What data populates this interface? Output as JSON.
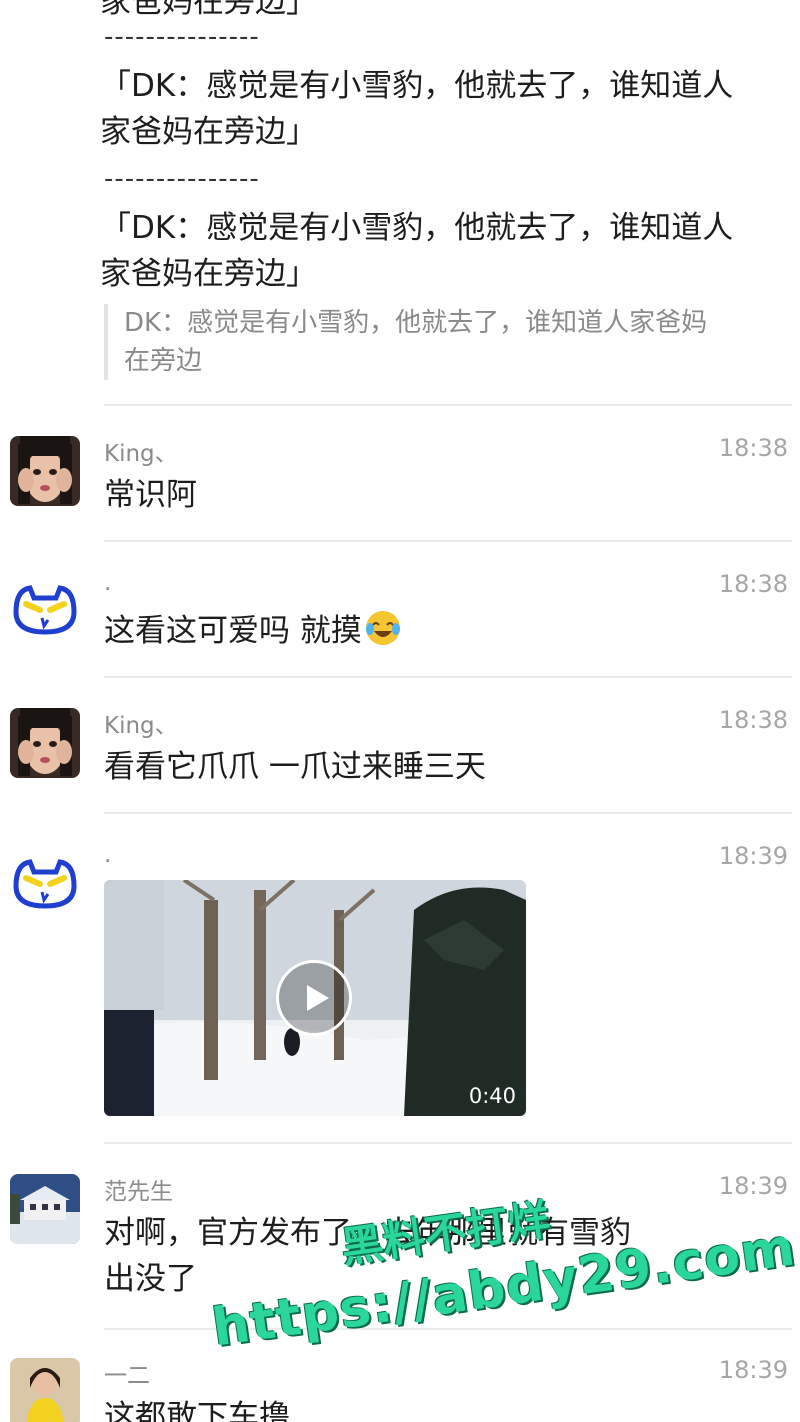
{
  "quotes": {
    "top_partial": "家爸妈在旁边」",
    "separator": "---------------",
    "q1_line1": "「DK：感觉是有小雪豹，他就去了，谁知道人",
    "q1_line2": "家爸妈在旁边」",
    "q2_line1": "「DK：感觉是有小雪豹，他就去了，谁知道人",
    "q2_line2": "家爸妈在旁边」",
    "ref_line1": "DK：感觉是有小雪豹，他就去了，谁知道人家爸妈",
    "ref_line2": "在旁边"
  },
  "messages": [
    {
      "sender": "King、",
      "time": "18:38",
      "text": "常识阿",
      "avatar": "girl-face-avatar"
    },
    {
      "sender": ".",
      "time": "18:38",
      "text": "这看这可爱吗 就摸",
      "emoji": "crying-laughing-emoji",
      "avatar": "blue-cat-avatar"
    },
    {
      "sender": "King、",
      "time": "18:38",
      "text": "看看它爪爪 一爪过来睡三天",
      "avatar": "girl-face-avatar"
    },
    {
      "sender": ".",
      "time": "18:39",
      "video_duration": "0:40",
      "avatar": "blue-cat-avatar"
    },
    {
      "sender": "范先生",
      "time": "18:39",
      "text_line1": "对啊，官方发布了，去年那里就有雪豹",
      "text_line2": "出没了",
      "avatar": "winter-house-avatar"
    },
    {
      "sender": "一二",
      "time": "18:39",
      "text": "这都敢下车撸",
      "avatar": "yellow-dress-avatar"
    }
  ],
  "watermark": {
    "line1": "黑料不打烊",
    "line2": "https://abdy29.com"
  }
}
